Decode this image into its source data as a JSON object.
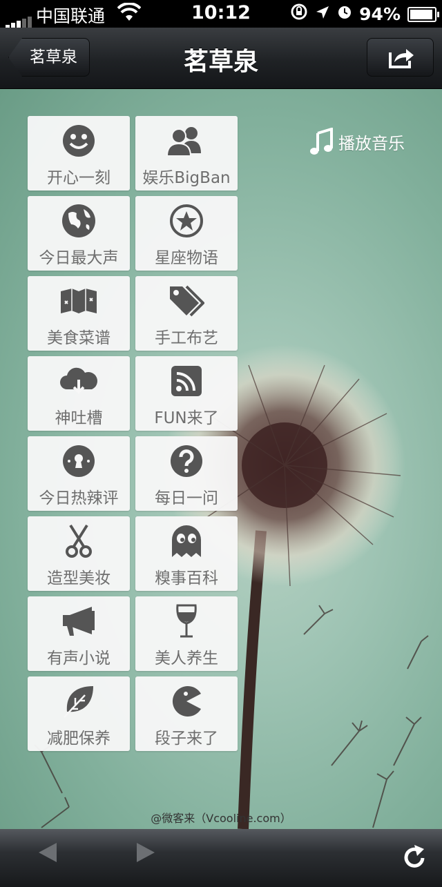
{
  "status_bar": {
    "carrier": "中国联通",
    "time": "10:12",
    "battery_percent": "94%"
  },
  "nav": {
    "title": "茗草泉",
    "back_label": "茗草泉"
  },
  "music_label": "播放音乐",
  "tiles": [
    {
      "label": "开心一刻",
      "icon": "smiley-icon"
    },
    {
      "label": "娱乐BigBan",
      "icon": "people-icon"
    },
    {
      "label": "今日最大声",
      "icon": "globe-icon"
    },
    {
      "label": "星座物语",
      "icon": "star-circle-icon"
    },
    {
      "label": "美食菜谱",
      "icon": "map-icon"
    },
    {
      "label": "手工布艺",
      "icon": "tag-icon"
    },
    {
      "label": "神吐槽",
      "icon": "cloud-download-icon"
    },
    {
      "label": "FUN来了",
      "icon": "rss-icon"
    },
    {
      "label": "今日热辣评",
      "icon": "keyhole-icon"
    },
    {
      "label": "每日一问",
      "icon": "question-icon"
    },
    {
      "label": "造型美妆",
      "icon": "scissors-icon"
    },
    {
      "label": "糗事百科",
      "icon": "ghost-icon"
    },
    {
      "label": "有声小说",
      "icon": "megaphone-icon"
    },
    {
      "label": "美人养生",
      "icon": "wine-glass-icon"
    },
    {
      "label": "减肥保养",
      "icon": "leaf-icon"
    },
    {
      "label": "段子来了",
      "icon": "pacman-icon"
    }
  ],
  "credit": "@微客来（Vcooline.com）",
  "colors": {
    "tile_icon": "#555555",
    "tile_label": "#6e6e6e",
    "nav_bg": "#1f2225"
  }
}
